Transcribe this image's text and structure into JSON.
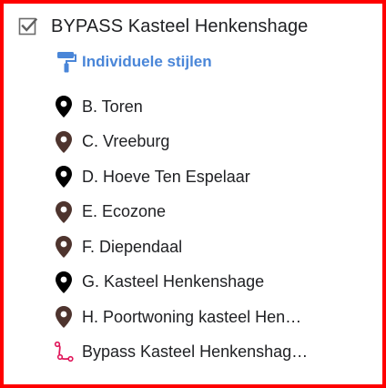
{
  "layer": {
    "checked": true,
    "title": "BYPASS Kasteel Henkenshage"
  },
  "styles_link": {
    "label": "Individuele stijlen",
    "color": "#4a86d8"
  },
  "features": [
    {
      "label": "B. Toren",
      "icon": "map-pin-icon",
      "color": "#000000"
    },
    {
      "label": "C. Vreeburg",
      "icon": "map-pin-icon",
      "color": "#4e342e"
    },
    {
      "label": "D. Hoeve Ten Espelaar",
      "icon": "map-pin-icon",
      "color": "#000000"
    },
    {
      "label": "E. Ecozone",
      "icon": "map-pin-icon",
      "color": "#4e342e"
    },
    {
      "label": "F. Diependaal",
      "icon": "map-pin-icon",
      "color": "#4e342e"
    },
    {
      "label": "G. Kasteel Henkenshage",
      "icon": "map-pin-icon",
      "color": "#000000"
    },
    {
      "label": "H. Poortwoning kasteel Hen…",
      "icon": "map-pin-icon",
      "color": "#4e342e"
    },
    {
      "label": "Bypass Kasteel Henkenshag…",
      "icon": "route-icon",
      "color": "#e0165a"
    }
  ],
  "colors": {
    "frame_border": "#ff0000"
  }
}
